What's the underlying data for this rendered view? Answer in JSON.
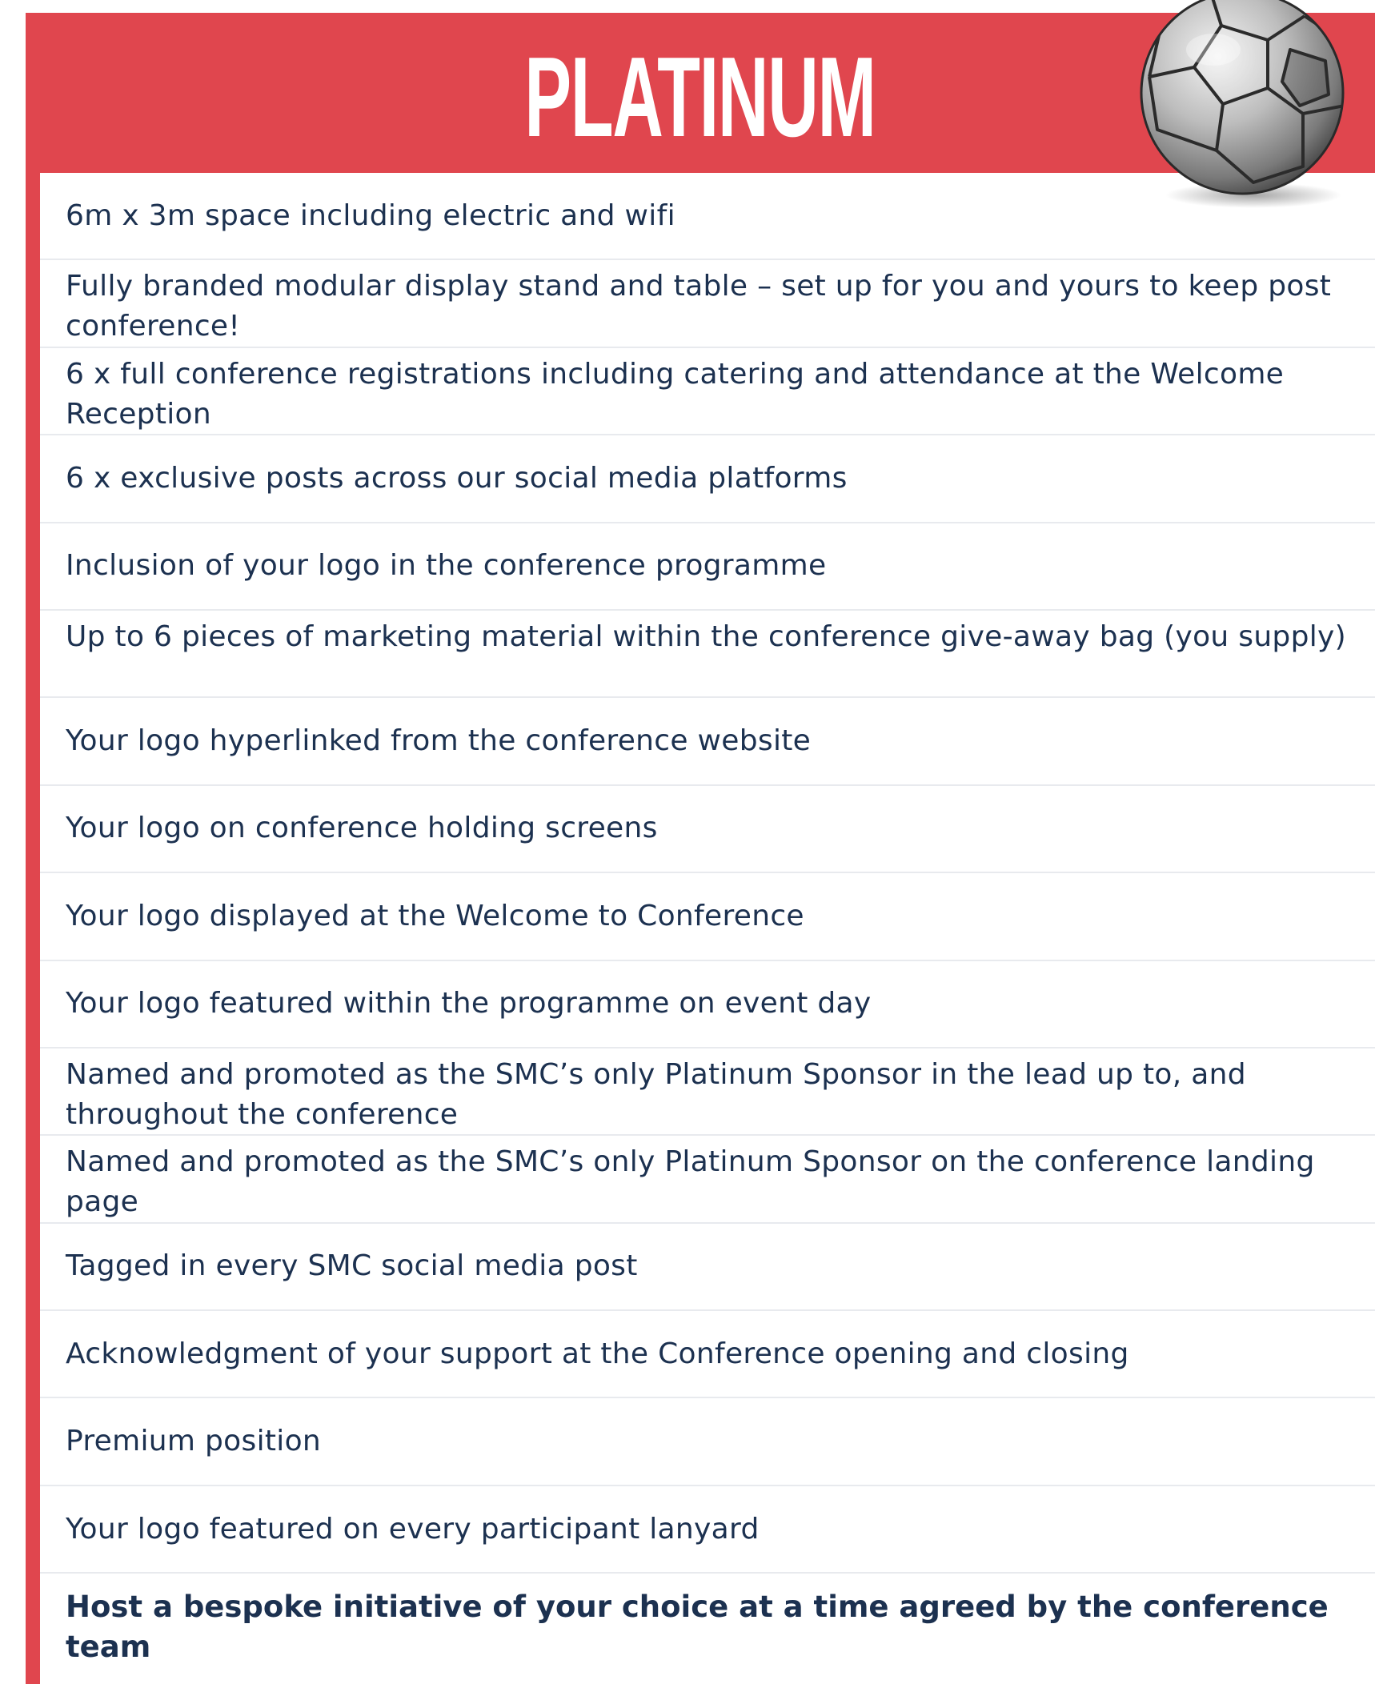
{
  "title": "PLATINUM",
  "colors": {
    "accent_red": "#e0464e",
    "text_navy": "#1c3150",
    "divider": "#e8eaee",
    "background": "#ffffff"
  },
  "decoration_icon": "soccer-ball-icon",
  "items": [
    "6m x 3m space including electric and wifi",
    "Fully branded modular display stand and table – set up for you and yours to keep post conference!",
    "6 x full conference registrations including catering and attendance at the Welcome Reception",
    "6 x exclusive posts across our social media platforms",
    "Inclusion of your logo in the conference programme",
    "Up to 6 pieces of marketing material within the conference give-away bag (you supply)",
    "Your logo hyperlinked from the conference website",
    "Your logo on conference holding screens",
    "Your logo displayed at the Welcome to Conference",
    "Your logo featured within the programme on event day",
    "Named and promoted as the SMC’s only Platinum Sponsor in the lead up to, and throughout the conference",
    "Named and promoted as the SMC’s only Platinum Sponsor on the conference landing page",
    "Tagged in every SMC social media post",
    "Acknowledgment of your support at the Conference opening and closing",
    "Premium position",
    "Your logo featured on every participant lanyard",
    "Host a bespoke initiative of your choice at a time agreed by the conference team"
  ]
}
